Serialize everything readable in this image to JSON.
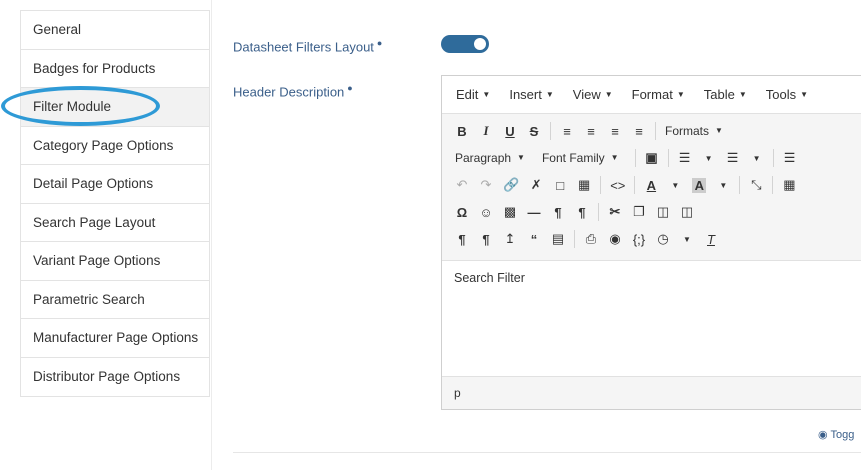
{
  "sidebar": {
    "items": [
      {
        "label": "General"
      },
      {
        "label": "Badges for Products"
      },
      {
        "label": "Filter Module"
      },
      {
        "label": "Category Page Options"
      },
      {
        "label": "Detail Page Options"
      },
      {
        "label": "Search Page Layout"
      },
      {
        "label": "Variant Page Options"
      },
      {
        "label": "Parametric Search"
      },
      {
        "label": "Manufacturer Page Options"
      },
      {
        "label": "Distributor Page Options"
      }
    ],
    "active_index": 2
  },
  "fields": {
    "datasheet_filters_layout": {
      "label": "Datasheet Filters Layout",
      "enabled": true,
      "info_icon": "info-circle-icon"
    },
    "header_description": {
      "label": "Header Description",
      "info_icon": "info-circle-icon"
    }
  },
  "editor": {
    "menus": [
      "Edit",
      "Insert",
      "View",
      "Format",
      "Table",
      "Tools"
    ],
    "formats_label": "Formats",
    "paragraph_label": "Paragraph",
    "font_family_label": "Font Family",
    "content": "Search Filter",
    "status_path": "p"
  },
  "toggle_link": {
    "label": "Togg",
    "icon": "eye-icon"
  },
  "colors": {
    "accent": "#2e9ad6",
    "toggle": "#2f6b9b",
    "label": "#3b5f8a"
  }
}
